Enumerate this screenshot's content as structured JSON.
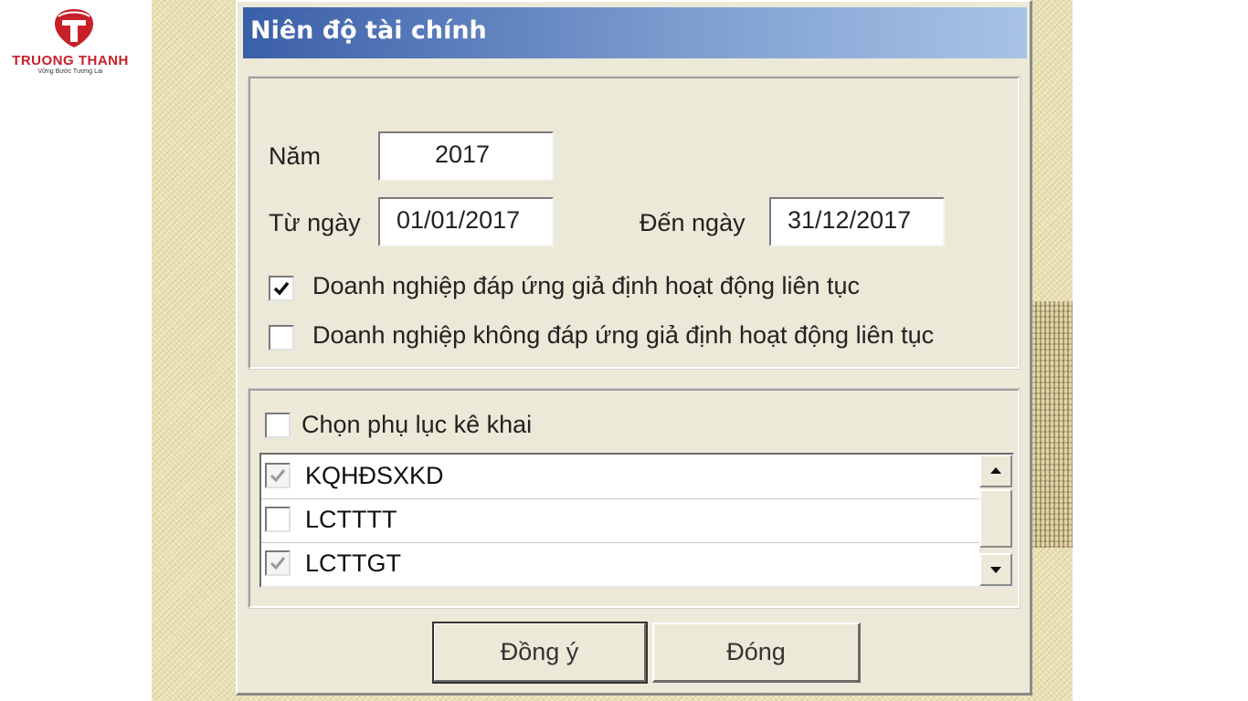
{
  "logo": {
    "name": "TRUONG THANH",
    "tagline": "Vững Bước Tương Lai"
  },
  "dialog": {
    "title": "Niên độ tài chính",
    "year_label": "Năm",
    "year_value": "2017",
    "from_label": "Từ ngày",
    "from_value": "01/01/2017",
    "to_label": "Đến ngày",
    "to_value": "31/12/2017",
    "option_going_concern": {
      "label": "Doanh nghiệp đáp ứng giả định hoạt động liên tục",
      "checked": true
    },
    "option_not_going_concern": {
      "label": "Doanh nghiệp không đáp ứng giả định hoạt động liên tục",
      "checked": false
    },
    "appendix_label": "Chọn phụ lục kê khai",
    "appendix_checked": false,
    "appendix_items": [
      {
        "label": "KQHĐSXKD",
        "checked": true
      },
      {
        "label": "LCTTTT",
        "checked": false
      },
      {
        "label": "LCTTGT",
        "checked": true
      }
    ],
    "ok_button": "Đồng ý",
    "close_button": "Đóng"
  },
  "colors": {
    "title_start": "#3b5fa8",
    "title_end": "#a8c3e6",
    "dialog_bg": "#ece9d8",
    "logo_red": "#c8202a"
  },
  "icons": [
    "logo-shield-icon",
    "check-icon",
    "scroll-up-icon",
    "scroll-down-icon"
  ]
}
